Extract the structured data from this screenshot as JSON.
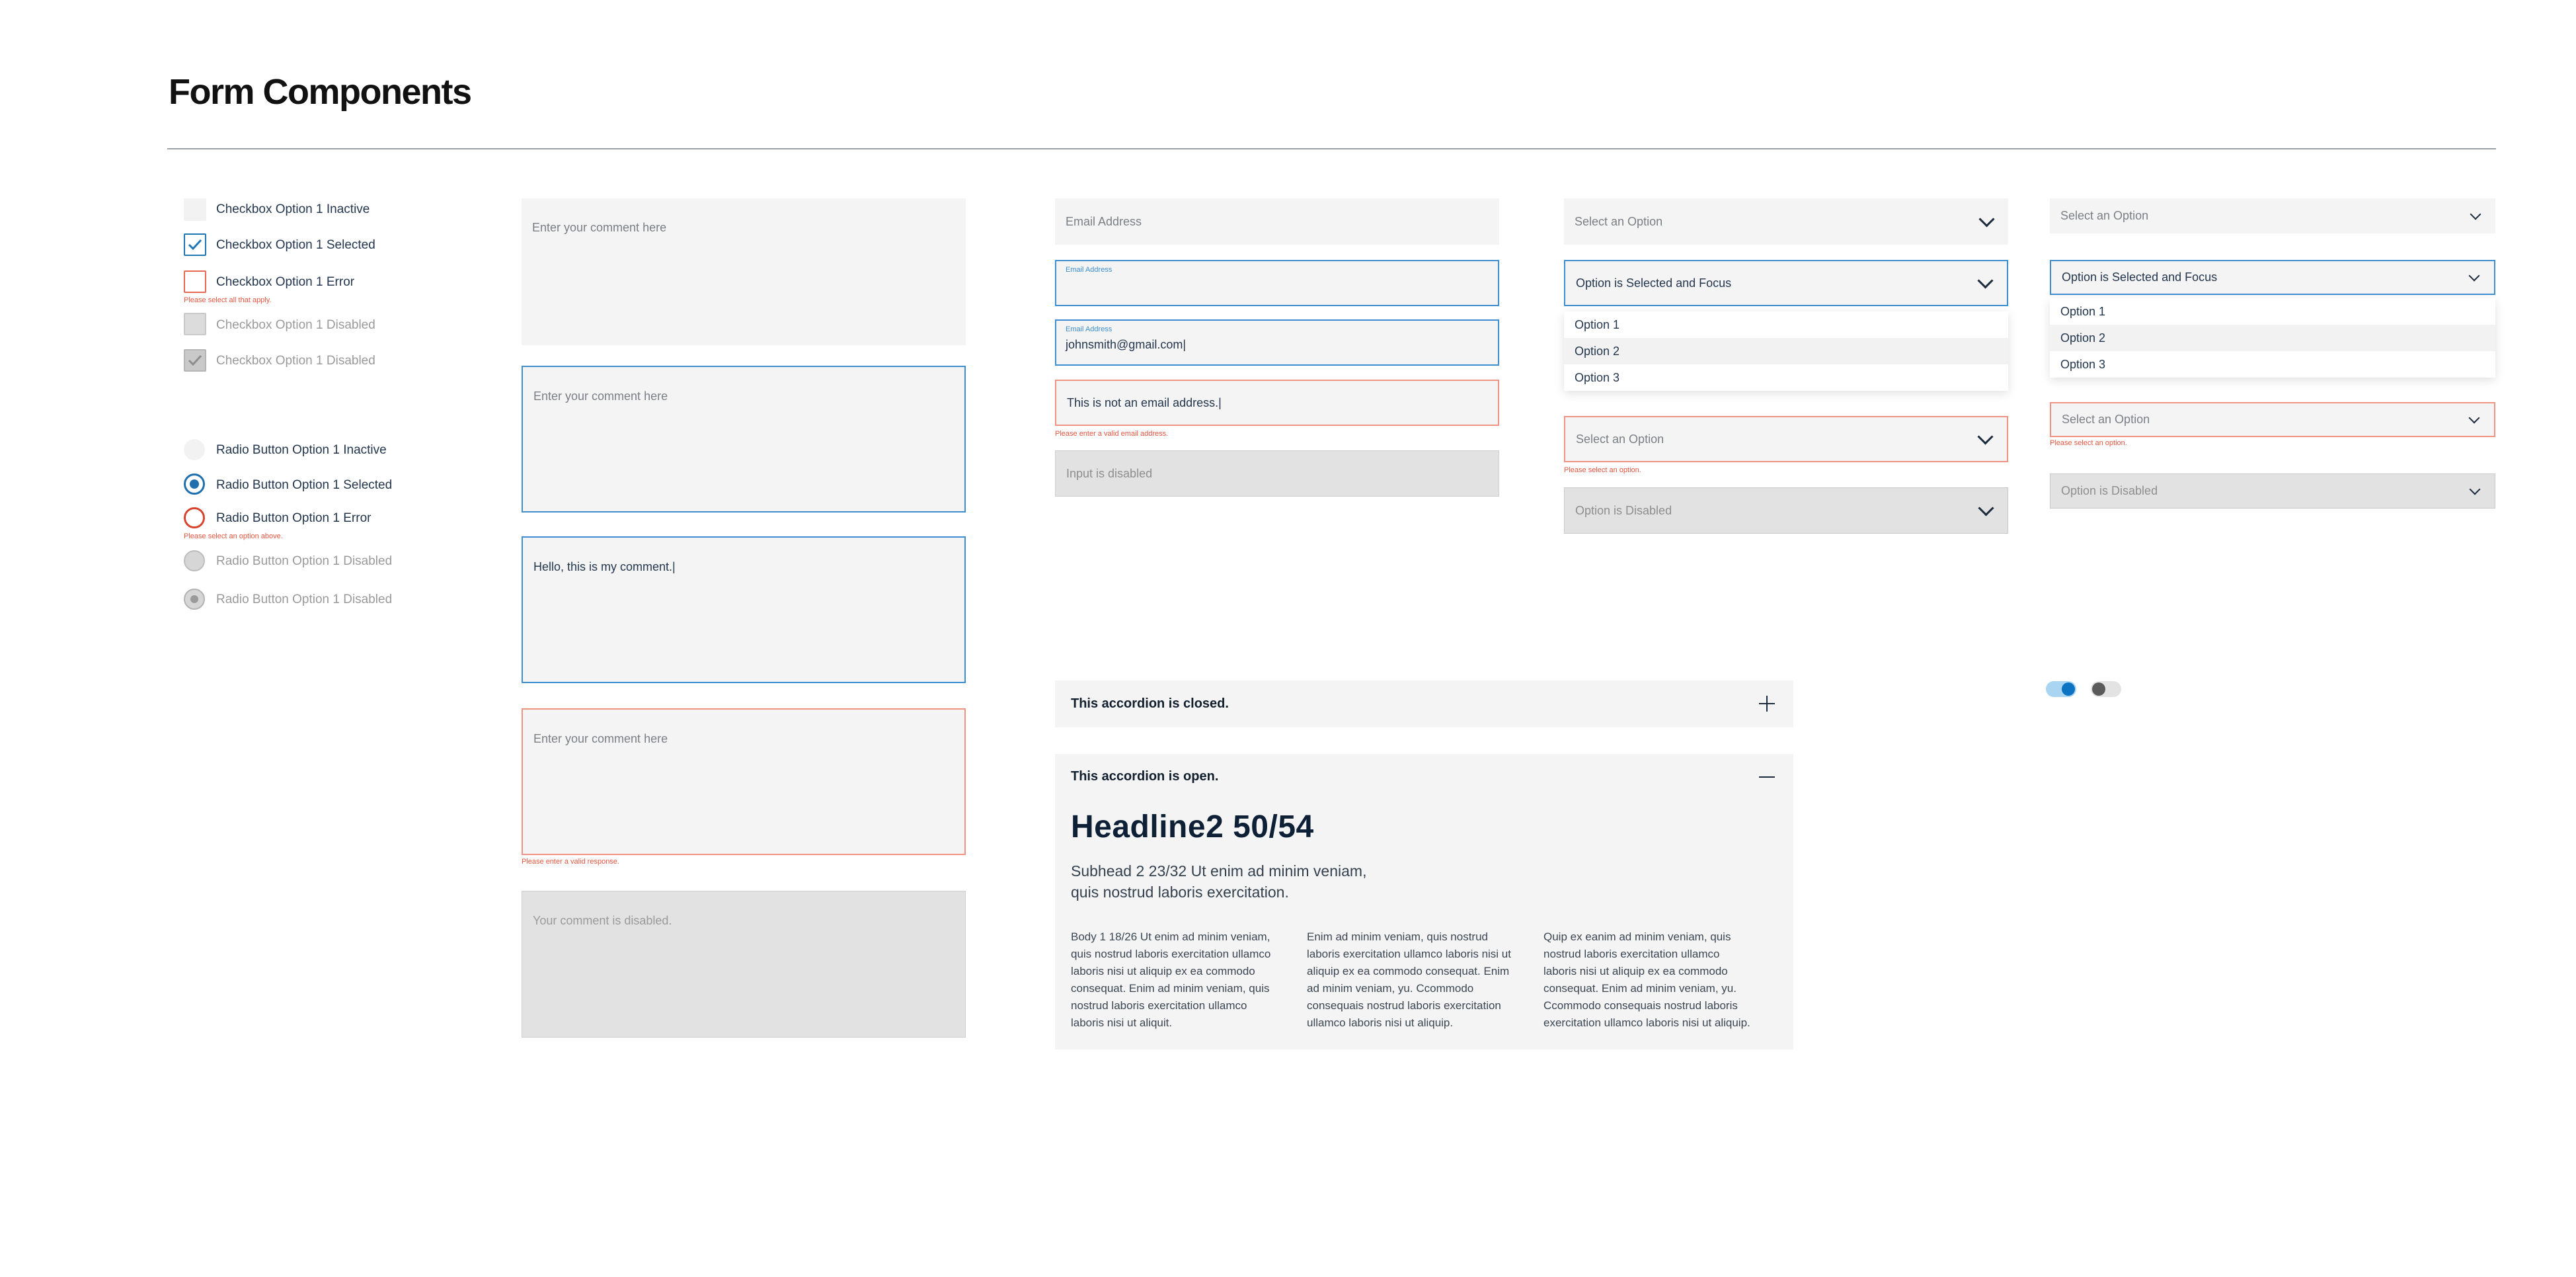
{
  "page": {
    "title": "Form Components"
  },
  "checkboxes": [
    {
      "label": "Checkbox Option 1 Inactive"
    },
    {
      "label": "Checkbox Option 1 Selected"
    },
    {
      "label": "Checkbox Option 1 Error",
      "error": "Please select all that apply."
    },
    {
      "label": "Checkbox Option 1 Disabled"
    },
    {
      "label": "Checkbox Option 1 Disabled"
    }
  ],
  "radios": [
    {
      "label": "Radio Button Option 1 Inactive"
    },
    {
      "label": "Radio Button Option 1 Selected"
    },
    {
      "label": "Radio Button Option 1 Error",
      "error": "Please select an option above."
    },
    {
      "label": "Radio Button Option 1 Disabled"
    },
    {
      "label": "Radio Button Option 1 Disabled"
    }
  ],
  "textareas": [
    {
      "placeholder": "Enter your comment here"
    },
    {
      "placeholder": "Enter your comment here"
    },
    {
      "value": "Hello, this is my comment.|"
    },
    {
      "placeholder": "Enter your comment here",
      "error": "Please enter a valid response."
    },
    {
      "placeholder": "Your comment is disabled."
    }
  ],
  "inputs": [
    {
      "placeholder": "Email Address"
    },
    {
      "label": "Email Address"
    },
    {
      "label": "Email Address",
      "value": "johnsmith@gmail.com|"
    },
    {
      "value": "This is not an email address.|",
      "error": "Please enter a valid email address."
    },
    {
      "placeholder": "Input is disabled"
    }
  ],
  "selects_large": {
    "default": "Select an Option",
    "focus": "Option is Selected and Focus",
    "options": [
      "Option 1",
      "Option 2",
      "Option 3"
    ],
    "error_placeholder": "Select an Option",
    "error": "Please select an option.",
    "disabled": "Option is Disabled"
  },
  "selects_small": {
    "default": "Select an Option",
    "focus": "Option is Selected and Focus",
    "options": [
      "Option 1",
      "Option 2",
      "Option 3"
    ],
    "error_placeholder": "Select an Option",
    "error": "Please select an option.",
    "disabled": "Option is Disabled"
  },
  "accordion": {
    "closed_title": "This accordion is closed.",
    "open_title": "This accordion is open.",
    "headline": "Headline2 50/54",
    "subhead_1": "Subhead 2 23/32 Ut enim ad minim veniam,",
    "subhead_2": "quis nostrud laboris exercitation.",
    "col1": [
      "Body 1 18/26 Ut enim ad minim veniam,",
      "quis nostrud laboris exercitation ullamco",
      "laboris nisi ut aliquip ex ea commodo",
      "consequat. Enim ad minim veniam, quis",
      "nostrud laboris exercitation ullamco",
      "laboris nisi ut aliquit."
    ],
    "col2": [
      "Enim ad minim veniam, quis nostrud",
      "laboris exercitation ullamco laboris nisi ut",
      "aliquip ex ea commodo consequat. Enim",
      "ad minim veniam, yu. Ccommodo",
      "consequais nostrud laboris exercitation",
      "ullamco laboris nisi ut aliquip."
    ],
    "col3": [
      "Quip ex eanim ad minim veniam, quis",
      "nostrud laboris exercitation ullamco",
      "laboris nisi ut aliquip ex ea commodo",
      "consequat. Enim ad minim veniam, yu.",
      "Ccommodo consequais nostrud laboris",
      "exercitation ullamco laboris nisi ut aliquip."
    ]
  },
  "toggles": [
    {
      "state": "on"
    },
    {
      "state": "off"
    }
  ],
  "colors": {
    "focus_blue": "#3d8fd1",
    "error_red": "#e5553f",
    "field_bg": "#f4f4f4",
    "disabled_bg": "#e2e2e2",
    "toggle_on": "#0d74c4"
  }
}
